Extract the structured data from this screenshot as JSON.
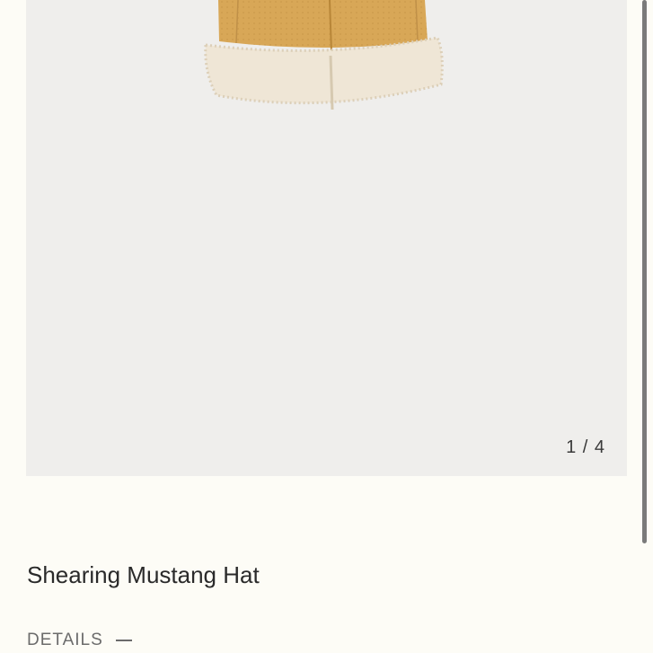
{
  "gallery": {
    "counter": "1 / 4",
    "image_icon": "hat-image"
  },
  "product": {
    "title": "Shearing Mustang Hat"
  },
  "details": {
    "label": "DETAILS",
    "toggle_icon": "minus-icon"
  }
}
